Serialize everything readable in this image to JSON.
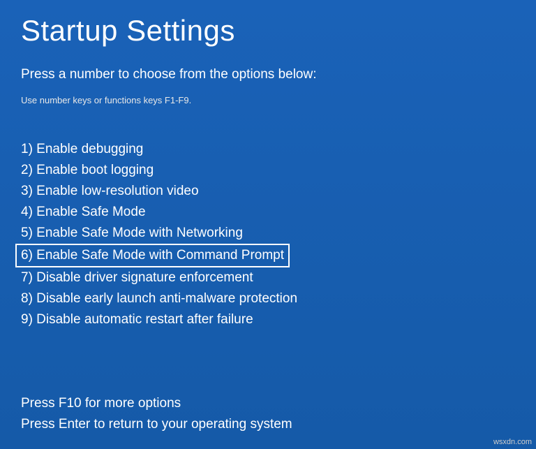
{
  "title": "Startup Settings",
  "subtitle": "Press a number to choose from the options below:",
  "hint": "Use number keys or functions keys F1-F9.",
  "options": [
    {
      "num": "1",
      "label": "Enable debugging",
      "highlighted": false
    },
    {
      "num": "2",
      "label": "Enable boot logging",
      "highlighted": false
    },
    {
      "num": "3",
      "label": "Enable low-resolution video",
      "highlighted": false
    },
    {
      "num": "4",
      "label": "Enable Safe Mode",
      "highlighted": false
    },
    {
      "num": "5",
      "label": "Enable Safe Mode with Networking",
      "highlighted": false
    },
    {
      "num": "6",
      "label": "Enable Safe Mode with Command Prompt",
      "highlighted": true
    },
    {
      "num": "7",
      "label": "Disable driver signature enforcement",
      "highlighted": false
    },
    {
      "num": "8",
      "label": "Disable early launch anti-malware protection",
      "highlighted": false
    },
    {
      "num": "9",
      "label": "Disable automatic restart after failure",
      "highlighted": false
    }
  ],
  "footer": {
    "more": "Press F10 for more options",
    "return": "Press Enter to return to your operating system"
  },
  "watermark": "wsxdn.com"
}
